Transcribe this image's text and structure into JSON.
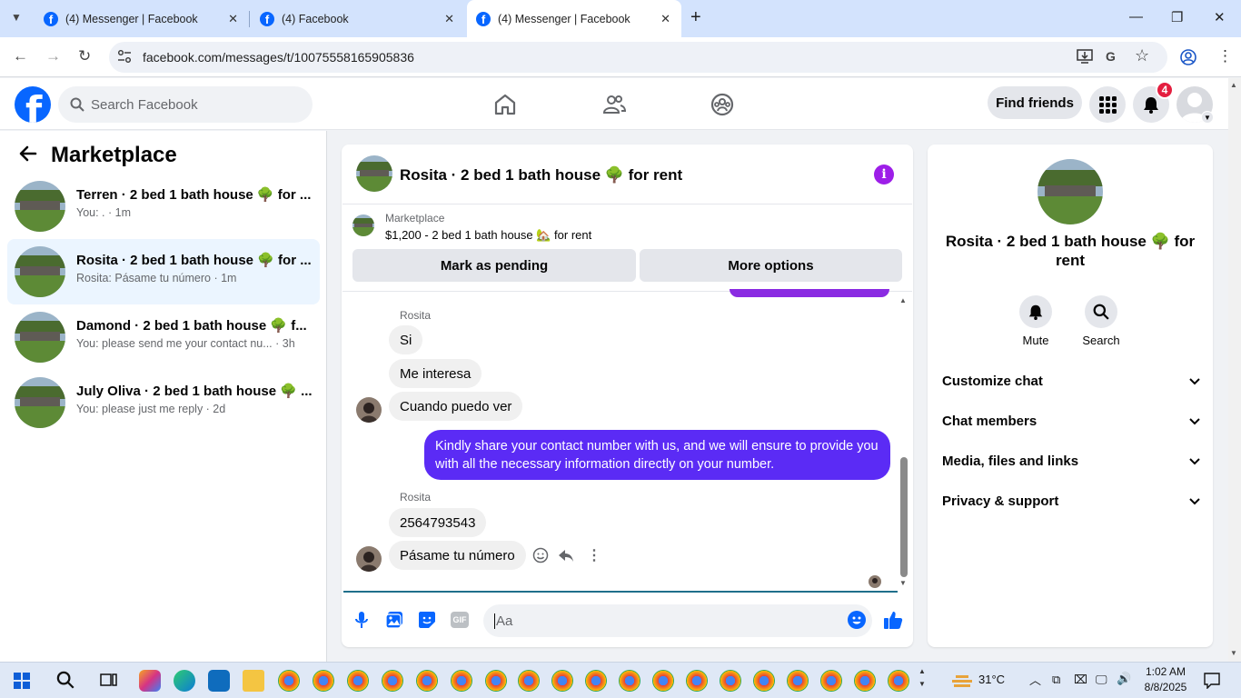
{
  "browser": {
    "tabs": [
      {
        "title": "(4) Messenger | Facebook",
        "active": false
      },
      {
        "title": "(4) Facebook",
        "active": false
      },
      {
        "title": "(4) Messenger | Facebook",
        "active": true
      }
    ],
    "url": "facebook.com/messages/t/10075558165905836"
  },
  "header": {
    "search_placeholder": "Search Facebook",
    "find_friends": "Find friends",
    "notification_count": "4"
  },
  "sidebar": {
    "title": "Marketplace",
    "conversations": [
      {
        "name": "Terren · 2 bed 1 bath house 🌳 for ...",
        "preview": "You: . · 1m",
        "selected": false
      },
      {
        "name": "Rosita · 2 bed 1 bath house 🌳 for ...",
        "preview": "Rosita: Pásame tu número · 1m",
        "selected": true
      },
      {
        "name": "Damond · 2 bed 1 bath house 🌳 f...",
        "preview": "You: please send me your contact nu... · 3h",
        "selected": false
      },
      {
        "name": "July Oliva · 2 bed 1 bath house 🌳 ...",
        "preview": "You: please just me reply · 2d",
        "selected": false
      }
    ]
  },
  "chat": {
    "title": "Rosita · 2 bed 1 bath house 🌳 for rent",
    "listing_label": "Marketplace",
    "listing_text": "$1,200 - 2 bed 1 bath house 🏡 for rent",
    "mark_pending": "Mark as pending",
    "more_options": "More options",
    "sender1": "Rosita",
    "msg1": "Si",
    "msg2": "Me interesa",
    "msg3": "Cuando puedo ver",
    "my_msg": "Kindly share your contact number with us, and we will ensure to provide you with all the necessary information directly on your number.",
    "sender2": "Rosita",
    "msg4": "2564793543",
    "msg5": "Pásame tu número",
    "composer_placeholder": "Aa",
    "accent_color": "#5b2bf5"
  },
  "details": {
    "name": "Rosita · 2 bed 1 bath house 🌳 for rent",
    "mute": "Mute",
    "search": "Search",
    "sections": [
      "Customize chat",
      "Chat members",
      "Media, files and links",
      "Privacy & support"
    ]
  },
  "taskbar": {
    "weather": "31°C",
    "time": "1:02 AM",
    "date": "8/8/2025"
  }
}
